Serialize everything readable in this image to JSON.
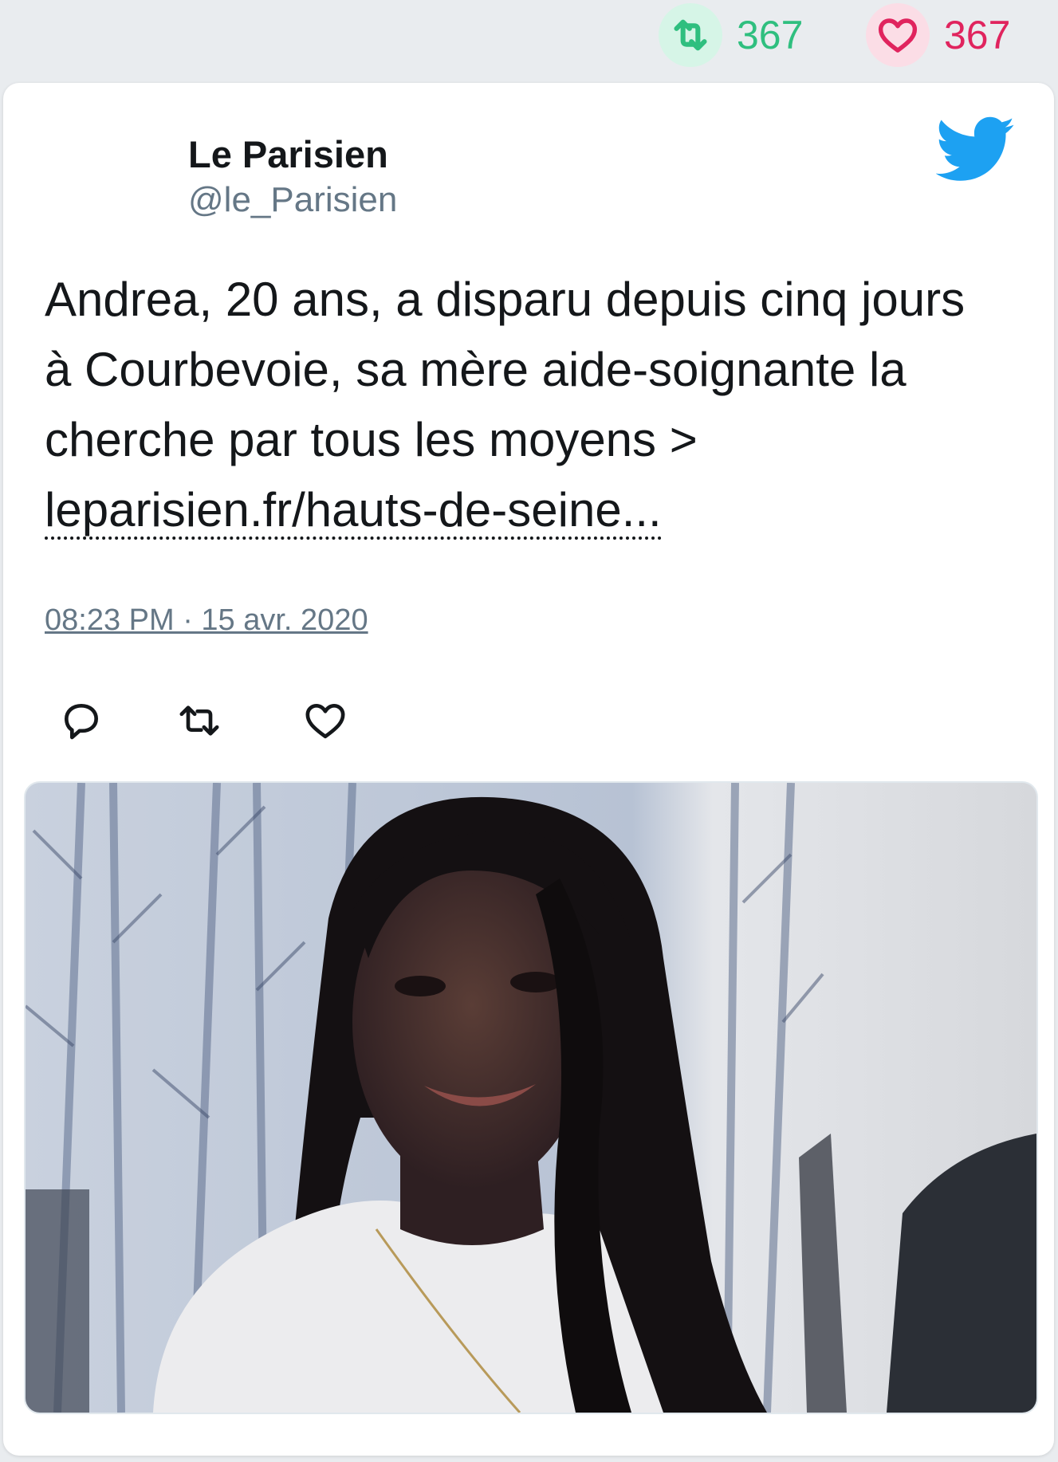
{
  "stats": {
    "retweets": "367",
    "likes": "367"
  },
  "tweet": {
    "author_name": "Le Parisien",
    "author_handle": "@le_Parisien",
    "text": "Andrea, 20 ans, a disparu depuis cinq jours à Courbevoie, sa mère aide-soignante la cherche par tous les moyens > ",
    "link_text": "leparisien.fr/hauts-de-seine...",
    "timestamp": "08:23 PM · 15 avr. 2020"
  },
  "icons": {
    "brand": "twitter-bird-icon",
    "reply": "reply-icon",
    "retweet": "retweet-icon",
    "like": "heart-icon"
  },
  "colors": {
    "retweet_green": "#2fbf7f",
    "like_red": "#e0245e",
    "twitter_blue": "#1da1f2",
    "muted_text": "#657786"
  }
}
